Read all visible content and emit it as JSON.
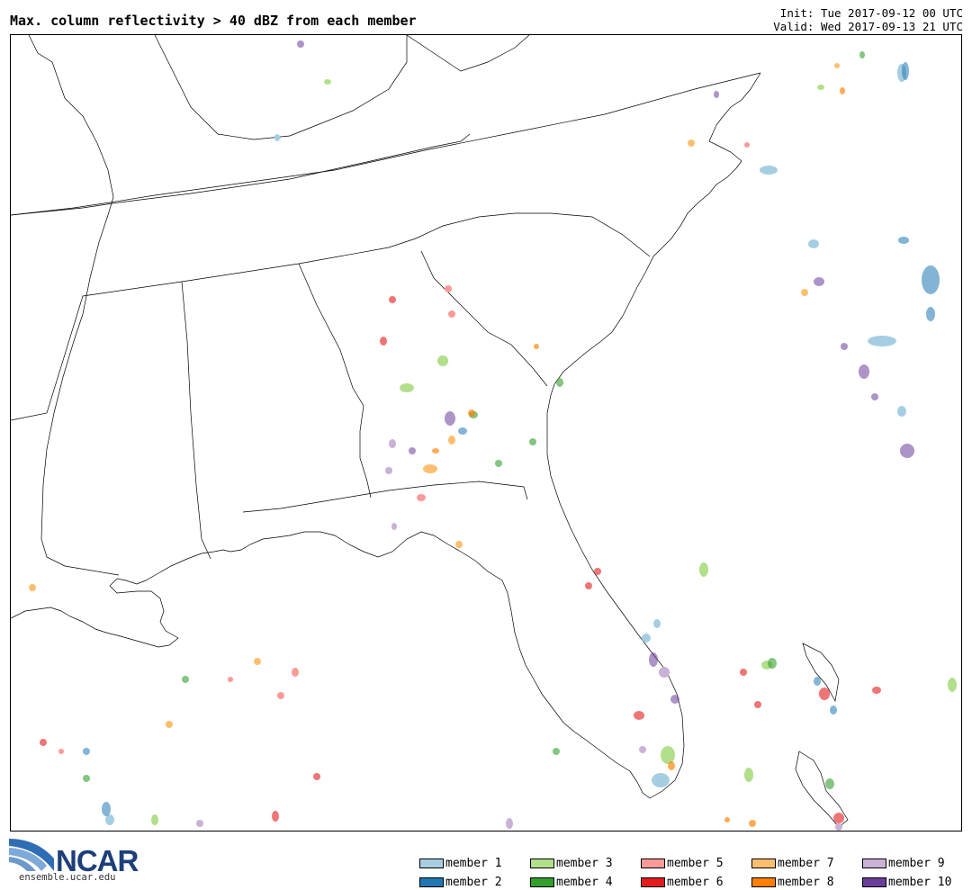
{
  "header": {
    "title": "Max. column reflectivity > 40 dBZ from each member",
    "init": "Init: Tue 2017-09-12 00 UTC",
    "valid": "Valid: Wed 2017-09-13 21 UTC"
  },
  "logo": {
    "text": "NCAR",
    "url": "ensemble.ucar.edu"
  },
  "legend": [
    {
      "label": "member 1",
      "color": "#a6cee3"
    },
    {
      "label": "member 2",
      "color": "#1f78b4"
    },
    {
      "label": "member 3",
      "color": "#b2df8a"
    },
    {
      "label": "member 4",
      "color": "#33a02c"
    },
    {
      "label": "member 5",
      "color": "#fb9a99"
    },
    {
      "label": "member 6",
      "color": "#e31a1c"
    },
    {
      "label": "member 7",
      "color": "#fdbf6f"
    },
    {
      "label": "member 8",
      "color": "#ff7f00"
    },
    {
      "label": "member 9",
      "color": "#cab2d6"
    },
    {
      "label": "member 10",
      "color": "#6a3d9a"
    }
  ]
}
